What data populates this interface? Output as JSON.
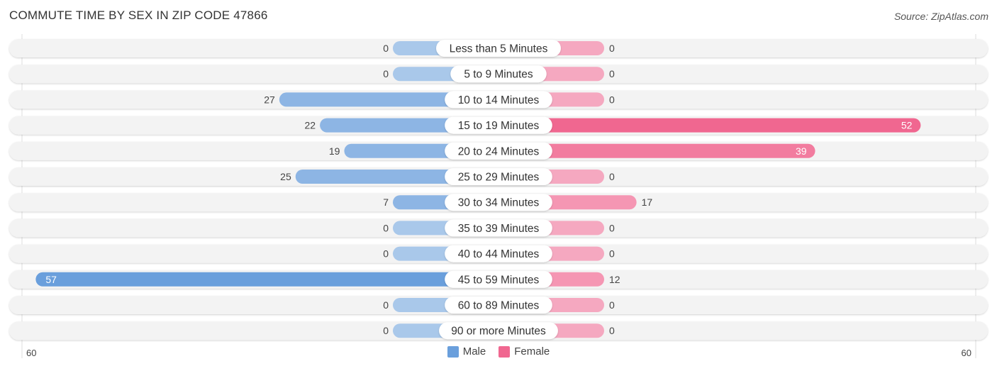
{
  "header": {
    "title": "COMMUTE TIME BY SEX IN ZIP CODE 47866",
    "source": "Source: ZipAtlas.com"
  },
  "colors": {
    "male": "#6a9fdc",
    "male_light": "#a9c8ea",
    "female": "#f06790",
    "female_light": "#f5a8c0",
    "row_bg": "#f3f3f3"
  },
  "chart_data": {
    "type": "bar",
    "orientation": "horizontal-diverging",
    "title": "COMMUTE TIME BY SEX IN ZIP CODE 47866",
    "categories": [
      "Less than 5 Minutes",
      "5 to 9 Minutes",
      "10 to 14 Minutes",
      "15 to 19 Minutes",
      "20 to 24 Minutes",
      "25 to 29 Minutes",
      "30 to 34 Minutes",
      "35 to 39 Minutes",
      "40 to 44 Minutes",
      "45 to 59 Minutes",
      "60 to 89 Minutes",
      "90 or more Minutes"
    ],
    "series": [
      {
        "name": "Male",
        "values": [
          0,
          0,
          27,
          22,
          19,
          25,
          7,
          0,
          0,
          57,
          0,
          0
        ]
      },
      {
        "name": "Female",
        "values": [
          0,
          0,
          0,
          52,
          39,
          0,
          17,
          0,
          0,
          12,
          0,
          0
        ]
      }
    ],
    "axis": {
      "left_label": "60",
      "right_label": "60",
      "range": [
        0,
        60
      ]
    },
    "legend": {
      "position": "bottom-center",
      "entries": [
        "Male",
        "Female"
      ]
    },
    "grid": false
  }
}
